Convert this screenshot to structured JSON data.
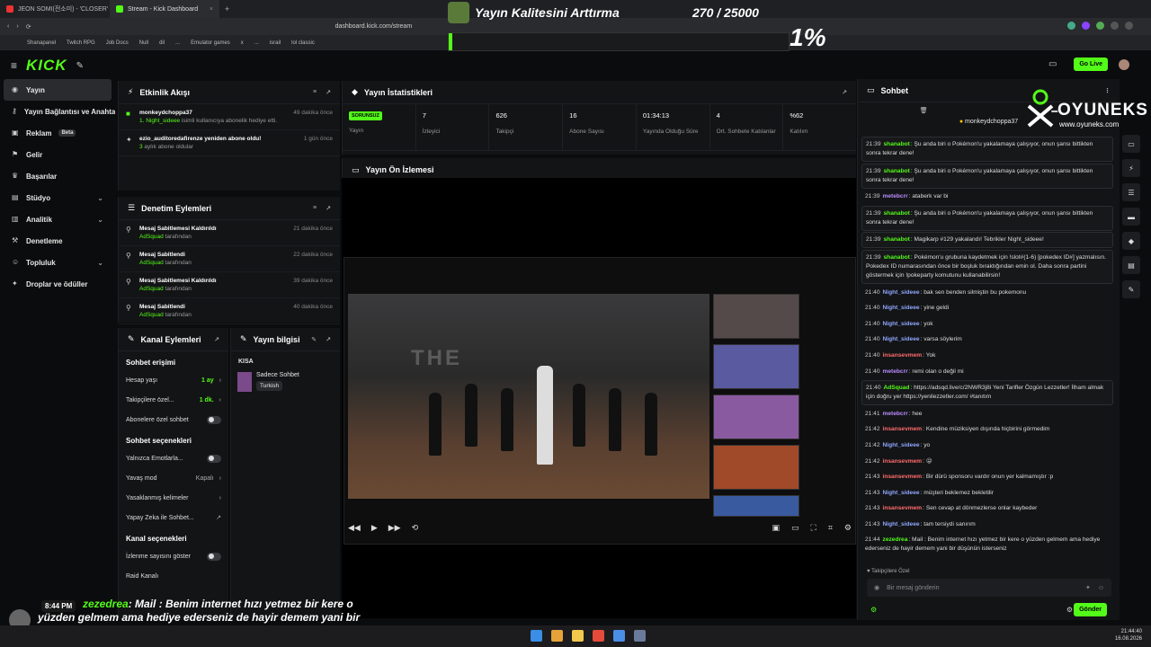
{
  "browser": {
    "tabs": [
      {
        "label": "JEON SOMI(전소미) - 'CLOSER' D",
        "active": false
      },
      {
        "label": "Stream - Kick Dashboard",
        "active": true
      }
    ],
    "url": "dashboard.kick.com/stream",
    "bookmarks": [
      "Shanapanel",
      "Twitch RPG",
      "Job Docs",
      "Null",
      "dil",
      "...",
      "Emulator games",
      "x",
      "...",
      "israil",
      "lol classic"
    ]
  },
  "overlay": {
    "goal_title": "Yayın Kalitesini Arttırma",
    "goal_count": "270 / 25000",
    "goal_percent": "1%",
    "goal_progress": 0.011,
    "chat_time": "8:44 PM",
    "chat_user": "zezedrea",
    "chat_text": ": Mail : Benim internet hızı yetmez bir kere o yüzden gelmem ama hediye ederseniz de hayir demem yani bir düşünün isterseniz"
  },
  "header": {
    "logo": "KICK",
    "go_live": "Go Live"
  },
  "sidebar": {
    "items": [
      {
        "label": "Yayın",
        "icon": "broadcast-icon",
        "active": true
      },
      {
        "label": "Yayın Bağlantısı ve Anahtarı",
        "icon": "key-icon"
      },
      {
        "label": "Reklam",
        "icon": "ad-icon",
        "badge": "Beta"
      },
      {
        "label": "Gelir",
        "icon": "revenue-icon"
      },
      {
        "label": "Başarılar",
        "icon": "trophy-icon"
      },
      {
        "label": "Stüdyo",
        "icon": "studio-icon",
        "chevron": true
      },
      {
        "label": "Analitik",
        "icon": "analytics-icon",
        "chevron": true
      },
      {
        "label": "Denetleme",
        "icon": "moderation-icon"
      },
      {
        "label": "Topluluk",
        "icon": "community-icon",
        "chevron": true
      },
      {
        "label": "Droplar ve ödüller",
        "icon": "gift-icon"
      }
    ]
  },
  "activity": {
    "title": "Etkinlik Akışı",
    "items": [
      {
        "user": "monkeydchoppa37",
        "detail_hl": "1. Night_sideee",
        "detail": " isimli kullanıcıya abonelik hediye etti.",
        "time": "49 dakika önce"
      },
      {
        "user": "ezio_auditoredafirenze yeniden abone oldu!",
        "detail_hl": "3",
        "detail": " aylık abone oldular",
        "time": "1 gün önce"
      }
    ]
  },
  "moderation": {
    "title": "Denetim Eylemleri",
    "items": [
      {
        "action": "Mesaj Sabitlemesi Kaldırıldı",
        "by": "AdSquad",
        "by_suffix": " tarafından",
        "time": "21 dakika önce"
      },
      {
        "action": "Mesaj Sabitlendi",
        "by": "AdSquad",
        "by_suffix": " tarafından",
        "time": "22 dakika önce"
      },
      {
        "action": "Mesaj Sabitlemesi Kaldırıldı",
        "by": "AdSquad",
        "by_suffix": " tarafından",
        "time": "39 dakika önce"
      },
      {
        "action": "Mesaj Sabitlendi",
        "by": "AdSquad",
        "by_suffix": " tarafından",
        "time": "40 dakika önce"
      }
    ]
  },
  "stats": {
    "title": "Yayın İstatistikleri",
    "status_badge": "SORUNSUZ",
    "items": [
      {
        "value": "",
        "label": "Yayın"
      },
      {
        "value": "7",
        "label": "İzleyici"
      },
      {
        "value": "626",
        "label": "Takipçi"
      },
      {
        "value": "16",
        "label": "Abone Sayısı"
      },
      {
        "value": "01:34:13",
        "label": "Yayında Olduğu Süre"
      },
      {
        "value": "4",
        "label": "Ort. Sohbete Katılanlar"
      },
      {
        "value": "%62",
        "label": "Katılım"
      }
    ]
  },
  "preview": {
    "title": "Yayın Ön İzlemesi"
  },
  "channel": {
    "title": "Kanal Eylemleri",
    "chat_access": "Sohbet erişimi",
    "rows1": [
      {
        "label": "Hesap yaşı",
        "value": "1 ay",
        "type": "select"
      },
      {
        "label": "Takipçilere özel...",
        "value": "1 dk.",
        "type": "select"
      },
      {
        "label": "Abonelere özel sohbet",
        "value": "",
        "type": "toggle"
      }
    ],
    "chat_options": "Sohbet seçenekleri",
    "rows2": [
      {
        "label": "Yalnızca Emotlarla...",
        "value": "",
        "type": "toggle"
      },
      {
        "label": "Yavaş mod",
        "value": "Kapalı",
        "type": "select"
      },
      {
        "label": "Yasaklanmış kelimeler",
        "value": "",
        "type": "link"
      },
      {
        "label": "Yapay Zeka ile Sohbet...",
        "value": "",
        "type": "external"
      }
    ],
    "channel_options": "Kanal seçenekleri",
    "rows3": [
      {
        "label": "İzlenme sayısını göster",
        "value": "",
        "type": "toggle"
      },
      {
        "label": "Raid Kanalı",
        "value": "",
        "type": "link"
      }
    ]
  },
  "streaminfo": {
    "title": "Yayın bilgisi",
    "section": "KISA",
    "category": "Sadece Sohbet",
    "tag": "Turkish"
  },
  "chat": {
    "title": "Sohbet",
    "pinned_user": "monkeydchoppa37",
    "messages": [
      {
        "time": "21:39",
        "user": "shanabot",
        "color": "#53fc18",
        "text": "Şu anda biri o Pokémon'u yakalamaya çalışıyor, onun şansı bittikten sonra tekrar dene!",
        "box": true
      },
      {
        "time": "21:39",
        "user": "shanabot",
        "color": "#53fc18",
        "text": "Şu anda biri o Pokémon'u yakalamaya çalışıyor, onun şansı bittikten sonra tekrar dene!",
        "box": true
      },
      {
        "time": "21:39",
        "user": "metebcrr",
        "color": "#b98cff",
        "text": "ataberk var bi",
        "box": false
      },
      {
        "time": "21:39",
        "user": "shanabot",
        "color": "#53fc18",
        "text": "Şu anda biri o Pokémon'u yakalamaya çalışıyor, onun şansı bittikten sonra tekrar dene!",
        "box": true
      },
      {
        "time": "21:39",
        "user": "shanabot",
        "color": "#53fc18",
        "text": "Magikarp #129 yakalandı! Tebrikler Night_sideee!",
        "box": true
      },
      {
        "time": "21:39",
        "user": "shanabot",
        "color": "#53fc18",
        "text": "Pokémon'u grubuna kaydetmek için !slot#(1-6) [pokedex ID#] yazmalısın. Pokedex ID numarasından önce bir boşluk bıraktığından emin ol. Daha sonra partini göstermek için !pokeparty komutunu kullanabilirsin!",
        "box": true
      },
      {
        "time": "21:40",
        "user": "Night_sideee",
        "color": "#8fa6ff",
        "text": "bak sen benden silmiştin bu pokemonu",
        "box": false
      },
      {
        "time": "21:40",
        "user": "Night_sideee",
        "color": "#8fa6ff",
        "text": "yine geldi",
        "box": false
      },
      {
        "time": "21:40",
        "user": "Night_sideee",
        "color": "#8fa6ff",
        "text": "yok",
        "box": false
      },
      {
        "time": "21:40",
        "user": "Night_sideee",
        "color": "#8fa6ff",
        "text": "varsa söylerim",
        "box": false
      },
      {
        "time": "21:40",
        "user": "insansevmem",
        "color": "#ff6b6b",
        "text": "Yok",
        "box": false
      },
      {
        "time": "21:40",
        "user": "metebcrr",
        "color": "#b98cff",
        "text": "remi olan o değil mi",
        "box": false
      },
      {
        "time": "21:40",
        "user": "AdSquad",
        "color": "#53fc18",
        "text": "https://adsqd.live/c/2NWR3j8i Yeni Tarifler Özgün Lezzetler! İlham almak için doğru yer https://yenilezzetler.com/ #tanıtım",
        "box": true
      },
      {
        "time": "21:41",
        "user": "metebcrr",
        "color": "#b98cff",
        "text": "hee",
        "box": false
      },
      {
        "time": "21:42",
        "user": "insansevmem",
        "color": "#ff6b6b",
        "text": "Kendine müziksiyen dışında hiçbirini görmedim",
        "box": false
      },
      {
        "time": "21:42",
        "user": "Night_sideee",
        "color": "#8fa6ff",
        "text": "yo",
        "box": false
      },
      {
        "time": "21:42",
        "user": "insansevmem",
        "color": "#ff6b6b",
        "text": "😜",
        "box": false
      },
      {
        "time": "21:43",
        "user": "insansevmem",
        "color": "#ff6b6b",
        "text": "Bir dürü sponsoru vardır onun yer kalmamıştır :p",
        "box": false
      },
      {
        "time": "21:43",
        "user": "Night_sideee",
        "color": "#8fa6ff",
        "text": "müşteri beklemez bekletilir",
        "box": false
      },
      {
        "time": "21:43",
        "user": "insansevmem",
        "color": "#ff6b6b",
        "text": "Sen cevap at dönmezlerse onlar kaybeder",
        "box": false
      },
      {
        "time": "21:43",
        "user": "Night_sideee",
        "color": "#8fa6ff",
        "text": "tam tersiydi sanırım",
        "box": false
      },
      {
        "time": "21:44",
        "user": "zezedrea",
        "color": "#53fc18",
        "text": "Mail : Benim internet hızı yetmez bir kere o yüzden gelmem ama hediye ederseniz de hayir demem yani bir düşünün isterseniz",
        "box": false
      }
    ],
    "followers_only": "Takipçilere Özel",
    "input_placeholder": "Bir mesaj gönderin",
    "send": "Gönder"
  },
  "branding": {
    "name": "OYUNEKS",
    "site": "www.oyuneks.com"
  },
  "clock": {
    "time": "21:44:40",
    "date": "16.08.2026"
  }
}
